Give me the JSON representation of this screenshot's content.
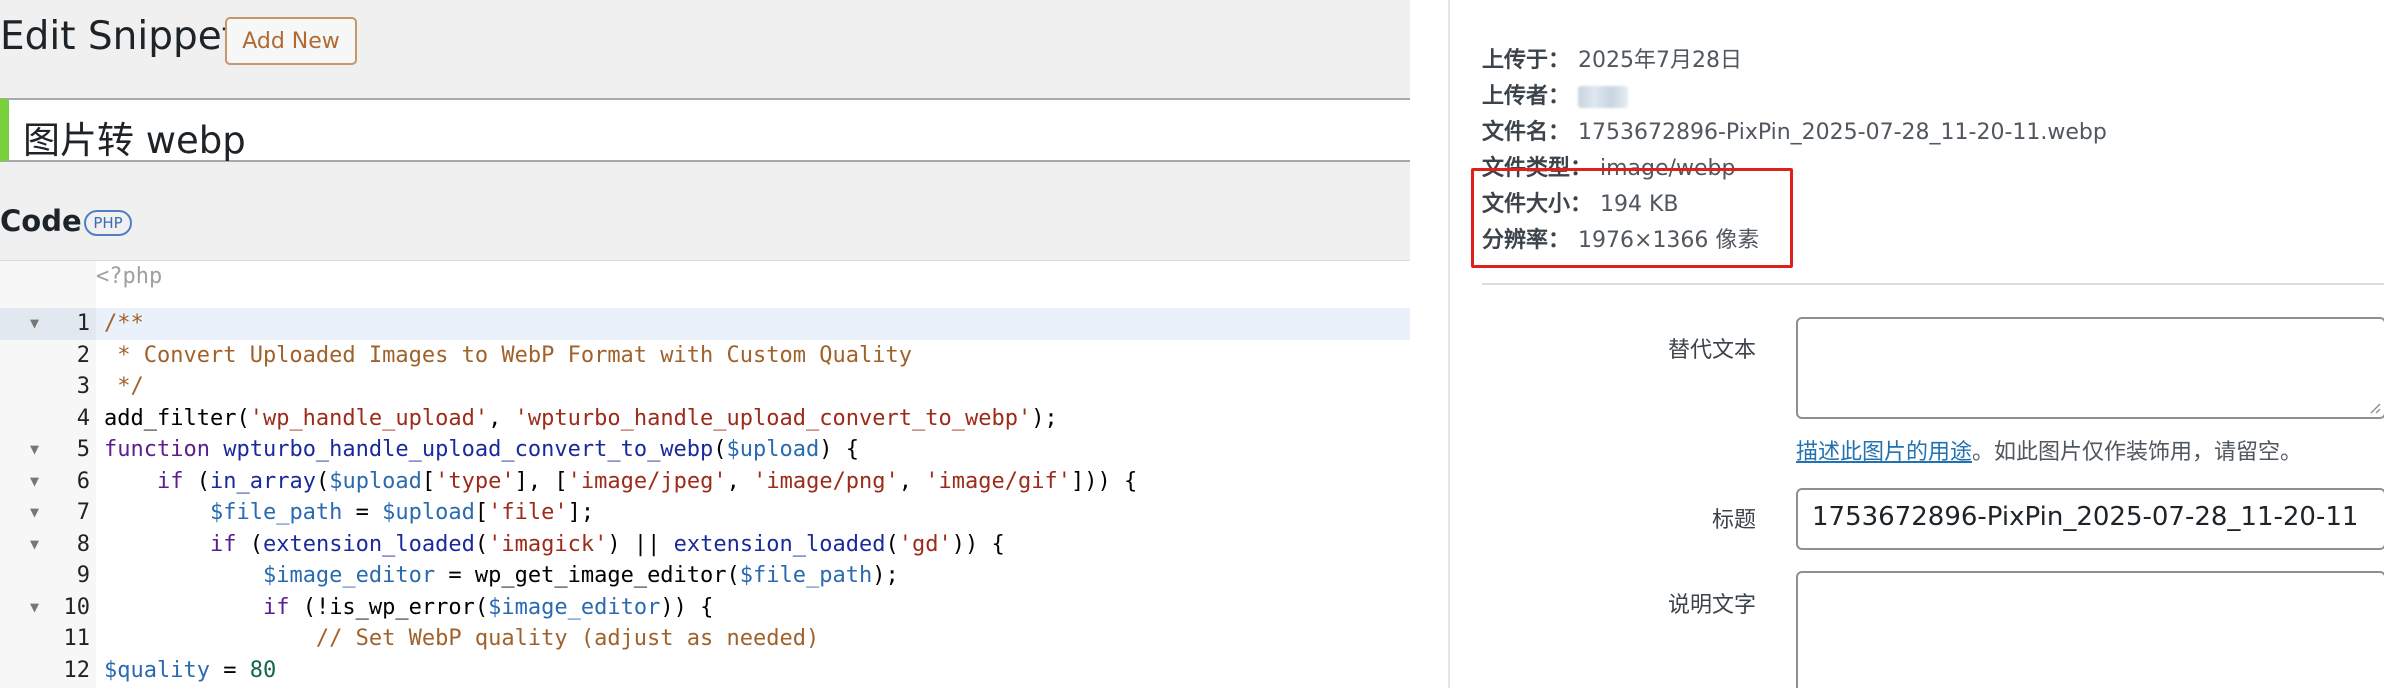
{
  "editor": {
    "page_title": "Edit Snippet",
    "add_new_label": "Add New",
    "snippet_title": "图片转 webp",
    "code_label": "Code",
    "code_lang_badge": "PHP",
    "php_open_tag": "<?php",
    "active_line": 1,
    "lines": [
      {
        "n": "1",
        "fold": true,
        "html": "<span class=\"c-comment\">/**</span>"
      },
      {
        "n": "2",
        "fold": false,
        "html": "<span class=\"c-comment\"> * Convert Uploaded Images to WebP Format with Custom Quality</span>"
      },
      {
        "n": "3",
        "fold": false,
        "html": "<span class=\"c-comment\"> */</span>"
      },
      {
        "n": "4",
        "fold": false,
        "html": "add_filter(<span class=\"c-str\">'wp_handle_upload'</span>, <span class=\"c-str\">'wpturbo_handle_upload_convert_to_webp'</span>);"
      },
      {
        "n": "5",
        "fold": true,
        "html": "<span class=\"c-kw\">function</span> <span class=\"c-fn\">wpturbo_handle_upload_convert_to_webp</span>(<span class=\"c-var\">$upload</span>) {"
      },
      {
        "n": "6",
        "fold": true,
        "html": "    <span class=\"c-kw\">if</span> (<span class=\"c-fn\">in_array</span>(<span class=\"c-var\">$upload</span>[<span class=\"c-str\">'type'</span>], [<span class=\"c-str\">'image/jpeg'</span>, <span class=\"c-str\">'image/png'</span>, <span class=\"c-str\">'image/gif'</span>])) {"
      },
      {
        "n": "7",
        "fold": true,
        "html": "        <span class=\"c-var\">$file_path</span> = <span class=\"c-var\">$upload</span>[<span class=\"c-str\">'file'</span>];"
      },
      {
        "n": "8",
        "fold": true,
        "html": "        <span class=\"c-kw\">if</span> (<span class=\"c-fn\">extension_loaded</span>(<span class=\"c-str\">'imagick'</span>) || <span class=\"c-fn\">extension_loaded</span>(<span class=\"c-str\">'gd'</span>)) {"
      },
      {
        "n": "9",
        "fold": false,
        "html": "            <span class=\"c-var\">$image_editor</span> = wp_get_image_editor(<span class=\"c-var\">$file_path</span>);"
      },
      {
        "n": "10",
        "fold": true,
        "html": "            <span class=\"c-kw\">if</span> (!is_wp_error(<span class=\"c-var\">$image_editor</span>)) {"
      },
      {
        "n": "11",
        "fold": false,
        "html": "                <span class=\"c-comment\">// Set WebP quality (adjust as needed)</span>"
      },
      {
        "n": "12",
        "fold": false,
        "html": "<span class=\"c-var\">$quality</span> = <span class=\"c-num\">80</span>"
      }
    ]
  },
  "attachment": {
    "uploaded_on_label": "上传于：",
    "uploaded_on_value": "2025年7月28日",
    "uploaded_by_label": "上传者：",
    "file_name_label": "文件名：",
    "file_name_value": "1753672896-PixPin_2025-07-28_11-20-11.webp",
    "file_type_label": "文件类型：",
    "file_type_value": "image/webp",
    "file_size_label": "文件大小：",
    "file_size_value": "194 KB",
    "dimensions_label": "分辨率：",
    "dimensions_value": "1976×1366 像素",
    "highlight_color": "#e0201c",
    "alt_text_label": "替代文本",
    "alt_text_value": "",
    "alt_help_link": "描述此图片的用途",
    "alt_help_rest": "。如此图片仅作装饰用，请留空。",
    "title_label": "标题",
    "title_value": "1753672896-PixPin_2025-07-28_11-20-11",
    "caption_label": "说明文字",
    "caption_value": ""
  },
  "colors": {
    "accent_green": "#7ad03a",
    "link_blue": "#2271b1",
    "add_new_orange": "#b26a30"
  }
}
